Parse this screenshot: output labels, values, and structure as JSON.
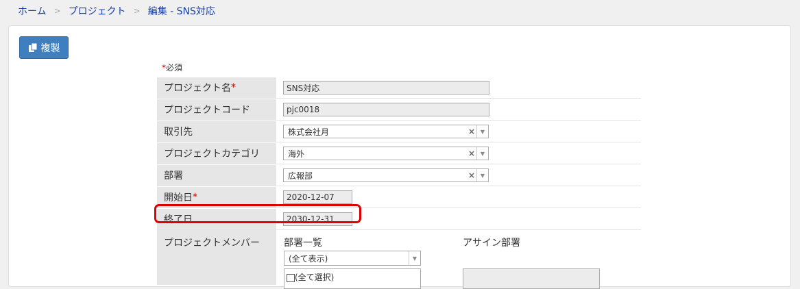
{
  "breadcrumb": {
    "home": "ホーム",
    "sep1": ">",
    "project": "プロジェクト",
    "sep2": ">",
    "current": "編集 - SNS対応"
  },
  "toolbar": {
    "duplicate_label": "複製",
    "duplicate_icon": "copy-icon"
  },
  "form": {
    "required_star": "*",
    "required_note": "必須",
    "fields": {
      "project_name": {
        "label": "プロジェクト名",
        "star": "*",
        "value": "SNS対応"
      },
      "project_code": {
        "label": "プロジェクトコード",
        "value": "pjc0018"
      },
      "client": {
        "label": "取引先",
        "value": "株式会社月",
        "clear": "×",
        "arrow": "▼"
      },
      "category": {
        "label": "プロジェクトカテゴリ",
        "value": "海外",
        "clear": "×",
        "arrow": "▼"
      },
      "department": {
        "label": "部署",
        "value": "広報部",
        "clear": "×",
        "arrow": "▼"
      },
      "start_date": {
        "label": "開始日",
        "star": "*",
        "value": "2020-12-07"
      },
      "end_date": {
        "label": "終了日",
        "value": "2030-12-31"
      }
    },
    "members": {
      "label": "プロジェクトメンバー",
      "dept_list_title": "部署一覧",
      "assign_title": "アサイン部署",
      "dept_filter_value": "(全て表示)",
      "dept_filter_arrow": "▼",
      "select_all_label": "(全て選択)"
    }
  },
  "colors": {
    "highlight": "#e00000",
    "button": "#3f7fbf",
    "link": "#1a3fa6",
    "required": "#cc0000"
  }
}
